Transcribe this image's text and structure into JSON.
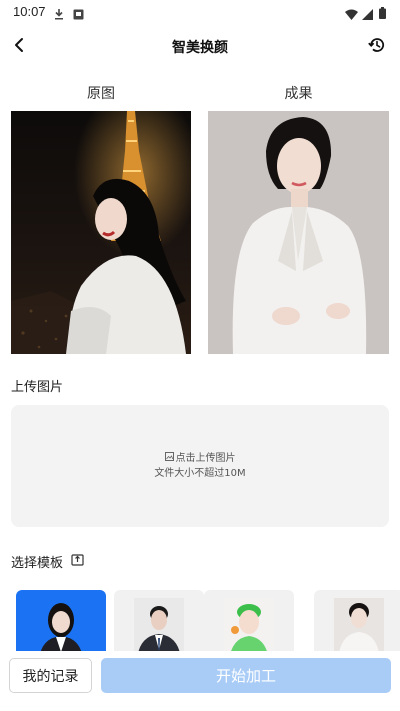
{
  "status_bar": {
    "time": "10:07",
    "left_icons": [
      "download-icon",
      "notification-icon"
    ],
    "right_icons": [
      "wifi-icon",
      "signal-icon",
      "battery-icon"
    ]
  },
  "header": {
    "title": "智美换颜",
    "back_icon": "back-arrow-icon",
    "history_icon": "history-icon"
  },
  "compare": {
    "original_label": "原图",
    "result_label": "成果"
  },
  "upload": {
    "section_title": "上传图片",
    "line1": "点击上传图片",
    "line2": "文件大小不超过10M",
    "icon": "image-icon"
  },
  "templates": {
    "section_title": "选择模板",
    "share_icon": "share-icon",
    "items": [
      {
        "name": "template-1",
        "selected": true
      },
      {
        "name": "template-2",
        "selected": false
      },
      {
        "name": "template-3",
        "selected": false
      },
      {
        "name": "template-4",
        "selected": false
      }
    ]
  },
  "footer": {
    "records_label": "我的记录",
    "start_label": "开始加工"
  },
  "colors": {
    "accent": "#1b73f3",
    "start_button": "#a9ccf7",
    "upload_bg": "#f3f3f3"
  }
}
